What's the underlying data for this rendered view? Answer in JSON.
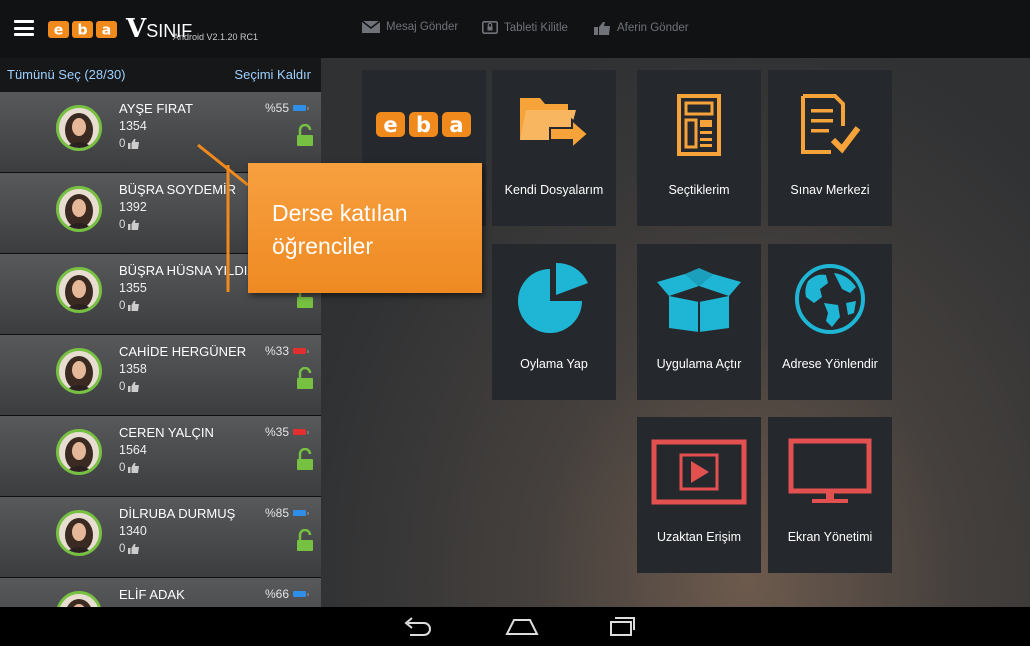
{
  "app": {
    "logo_text": "eba",
    "brand_mark": "V",
    "brand_text": "SINIF",
    "version": "Android V2.1.20 RC1"
  },
  "top_actions": [
    {
      "label": "Mesaj Gönder",
      "icon": "envelope-icon"
    },
    {
      "label": "Tableti Kilitle",
      "icon": "tablet-lock-icon"
    },
    {
      "label": "Aferin Gönder",
      "icon": "thumbs-up-icon"
    }
  ],
  "sidebar": {
    "select_all": "Tümünü Seç (28/30)",
    "deselect": "Seçimi Kaldır",
    "students": [
      {
        "name": "AYŞE FIRAT",
        "number": "1354",
        "likes": "0",
        "battery": "%55",
        "battery_color": "#2f8fe8"
      },
      {
        "name": "BÜŞRA SOYDEMİR",
        "number": "1392",
        "likes": "0",
        "battery": "",
        "battery_color": "#2f8fe8"
      },
      {
        "name": "BÜŞRA HÜSNA YILDIZ",
        "number": "1355",
        "likes": "0",
        "battery": "",
        "battery_color": "#2f8fe8"
      },
      {
        "name": "CAHİDE HERGÜNER",
        "number": "1358",
        "likes": "0",
        "battery": "%33",
        "battery_color": "#e23030"
      },
      {
        "name": "CEREN YALÇIN",
        "number": "1564",
        "likes": "0",
        "battery": "%35",
        "battery_color": "#e23030"
      },
      {
        "name": "DİLRUBA DURMUŞ",
        "number": "1340",
        "likes": "0",
        "battery": "%85",
        "battery_color": "#2f8fe8"
      },
      {
        "name": "ELİF ADAK",
        "number": "",
        "likes": "",
        "battery": "%66",
        "battery_color": "#2f8fe8"
      }
    ]
  },
  "tiles": [
    {
      "label": "",
      "icon": "eba-logo-icon"
    },
    {
      "label": "Kendi Dosyalarım",
      "icon": "folder-transfer-icon"
    },
    {
      "label": "Seçtiklerim",
      "icon": "selection-list-icon"
    },
    {
      "label": "Sınav Merkezi",
      "icon": "exam-check-icon"
    },
    {
      "label": "Oylama Yap",
      "icon": "pie-chart-icon"
    },
    {
      "label": "Uygulama Açtır",
      "icon": "open-box-icon"
    },
    {
      "label": "Adrese Yönlendir",
      "icon": "globe-icon"
    },
    {
      "label": "Uzaktan Erişim",
      "icon": "play-screen-icon"
    },
    {
      "label": "Ekran Yönetimi",
      "icon": "monitor-icon"
    }
  ],
  "callout": {
    "line1": "Derse katılan",
    "line2": "öğrenciler"
  },
  "colors": {
    "accent_orange": "#f6a33a",
    "accent_cyan": "#1fb6d6",
    "accent_red": "#e25050",
    "online_green": "#7ec142"
  }
}
